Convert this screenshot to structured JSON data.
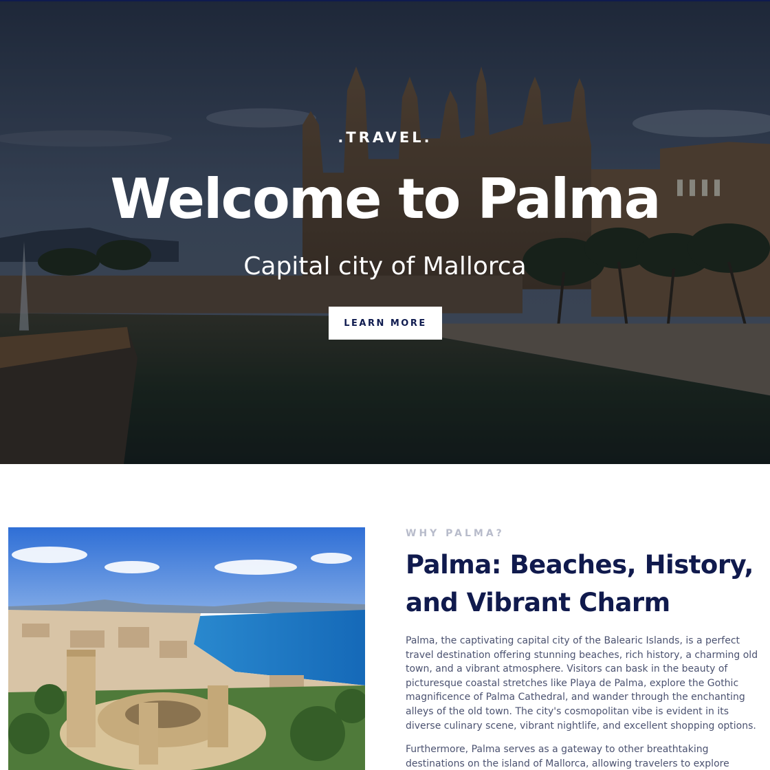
{
  "hero": {
    "eyebrow": ".TRAVEL.",
    "title": "Welcome to Palma",
    "subtitle": "Capital city of Mallorca",
    "button_label": "LEARN MORE",
    "image": "palma-cathedral-photo"
  },
  "about": {
    "image": "bellver-castle-aerial-photo",
    "eyebrow": "WHY PALMA?",
    "title": "Palma: Beaches, History, and Vibrant Charm",
    "paragraphs": [
      "Palma, the captivating capital city of the Balearic Islands, is a perfect travel destination offering stunning beaches, rich history, a charming old town, and a vibrant atmosphere. Visitors can bask in the beauty of picturesque coastal stretches like Playa de Palma, explore the Gothic magnificence of Palma Cathedral, and wander through the enchanting alleys of the old town. The city's cosmopolitan vibe is evident in its diverse culinary scene, vibrant nightlife, and excellent shopping options.",
      "Furthermore, Palma serves as a gateway to other breathtaking destinations on the island of Mallorca, allowing travelers to explore charming coastal towns and captivating natural landscapes. With its irresistible combination"
    ]
  },
  "colors": {
    "navy": "#101a4d",
    "muted": "#b8bccb",
    "body_text": "#4b5270",
    "button_bg": "#ffffff"
  }
}
